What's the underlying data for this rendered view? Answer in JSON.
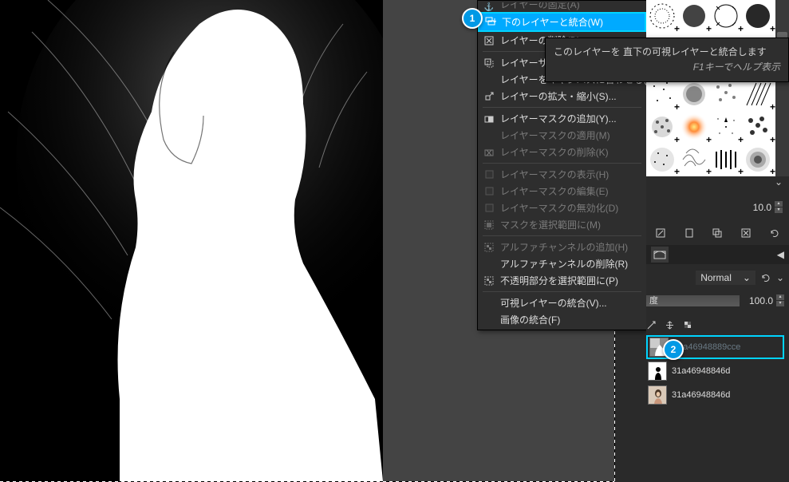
{
  "callouts": {
    "one": "1",
    "two": "2"
  },
  "menu": {
    "items": [
      {
        "icon": "anchor-icon",
        "label": "レイヤーの固定(A)",
        "state": "cut-disabled"
      },
      {
        "icon": "merge-down-icon",
        "label": "下のレイヤーと統合(W)",
        "state": "highlighted"
      },
      {
        "icon": "delete-icon",
        "label": "レイヤーの削除(D)",
        "state": "enabled"
      },
      {
        "sep": true
      },
      {
        "icon": "resize-icon",
        "label": "レイヤーサイズ",
        "state": "enabled-cut"
      },
      {
        "icon": "",
        "label": "レイヤーをキャンバスに合わせる(I)",
        "state": "enabled"
      },
      {
        "icon": "scale-icon",
        "label": "レイヤーの拡大・縮小(S)...",
        "state": "enabled"
      },
      {
        "sep": true
      },
      {
        "icon": "mask-add-icon",
        "label": "レイヤーマスクの追加(Y)...",
        "state": "enabled"
      },
      {
        "icon": "",
        "label": "レイヤーマスクの適用(M)",
        "state": "disabled"
      },
      {
        "icon": "mask-del-icon",
        "label": "レイヤーマスクの削除(K)",
        "state": "disabled"
      },
      {
        "sep": true
      },
      {
        "icon": "checkbox-icon",
        "label": "レイヤーマスクの表示(H)",
        "state": "disabled"
      },
      {
        "icon": "checkbox-icon",
        "label": "レイヤーマスクの編集(E)",
        "state": "disabled"
      },
      {
        "icon": "checkbox-icon",
        "label": "レイヤーマスクの無効化(D)",
        "state": "disabled"
      },
      {
        "icon": "mask-sel-icon",
        "label": "マスクを選択範囲に(M)",
        "state": "disabled"
      },
      {
        "sep": true
      },
      {
        "icon": "alpha-add-icon",
        "label": "アルファチャンネルの追加(H)",
        "state": "disabled"
      },
      {
        "icon": "",
        "label": "アルファチャンネルの削除(R)",
        "state": "enabled"
      },
      {
        "icon": "alpha-sel-icon",
        "label": "不透明部分を選択範囲に(P)",
        "state": "enabled"
      },
      {
        "sep": true
      },
      {
        "icon": "",
        "label": "可視レイヤーの統合(V)...",
        "state": "enabled"
      },
      {
        "icon": "",
        "label": "画像の統合(F)",
        "state": "enabled"
      }
    ]
  },
  "tooltip": {
    "line1": "このレイヤーを 直下の可視レイヤーと統合します",
    "line2": "F1キーでヘルプ表示"
  },
  "brushPanel": {
    "spacing_value": "10.0"
  },
  "layerPanel": {
    "mode_label": "Normal",
    "opacity_label": "度",
    "opacity_value": "100.0",
    "layers": [
      {
        "name": "31a46948889cce",
        "thumb": "checker"
      },
      {
        "name": "31a46948846d",
        "thumb": "mask"
      },
      {
        "name": "31a46948846d",
        "thumb": "photo"
      }
    ]
  }
}
